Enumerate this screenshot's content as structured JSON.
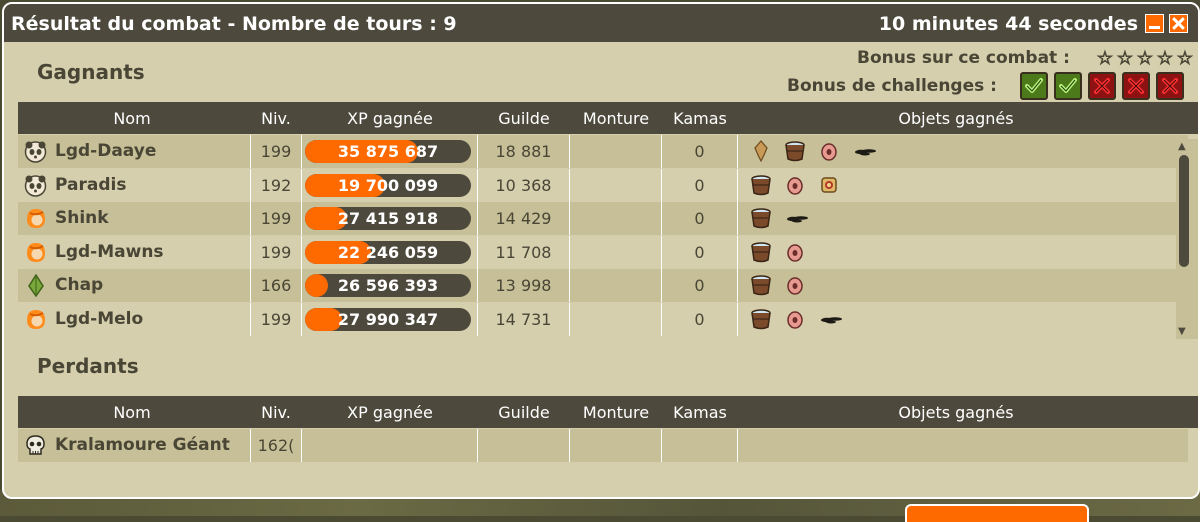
{
  "window": {
    "title": "Résultat du combat - Nombre de tours : 9",
    "timer": "10 minutes 44 secondes"
  },
  "bonus": {
    "combat_label": "Bonus sur ce combat :",
    "combat_stars": 0,
    "combat_stars_max": 5,
    "challenges_label": "Bonus de challenges :",
    "challenges": [
      "success",
      "success",
      "fail",
      "fail",
      "fail"
    ]
  },
  "columns": [
    "Nom",
    "Niv.",
    "XP gagnée",
    "Guilde",
    "Monture",
    "Kamas",
    "Objets gagnés"
  ],
  "winners": {
    "title": "Gagnants",
    "rows": [
      {
        "name": "Lgd-Daaye",
        "avatar": "panda-icon",
        "level": "199",
        "xp": "35 875 687",
        "xp_progress": 0.68,
        "guild": "18 881",
        "mount": "",
        "kamas": "0",
        "items": [
          "leaf-item-icon",
          "bucket-item-icon",
          "pink-stone-icon",
          "black-flower-icon"
        ]
      },
      {
        "name": "Paradis",
        "avatar": "panda-icon",
        "level": "192",
        "xp": "19 700 099",
        "xp_progress": 0.48,
        "guild": "10 368",
        "mount": "",
        "kamas": "0",
        "items": [
          "bucket-item-icon",
          "pink-stone-icon",
          "scroll-item-icon"
        ]
      },
      {
        "name": "Shink",
        "avatar": "cra-icon",
        "level": "199",
        "xp": "27 415 918",
        "xp_progress": 0.25,
        "guild": "14 429",
        "mount": "",
        "kamas": "0",
        "items": [
          "bucket-item-icon",
          "black-flower-icon"
        ]
      },
      {
        "name": "Lgd-Mawns",
        "avatar": "cra-icon",
        "level": "199",
        "xp": "22 246 059",
        "xp_progress": 0.4,
        "guild": "11 708",
        "mount": "",
        "kamas": "0",
        "items": [
          "bucket-item-icon",
          "pink-stone-icon"
        ]
      },
      {
        "name": "Chap",
        "avatar": "sadida-icon",
        "level": "166",
        "xp": "26 596 393",
        "xp_progress": 0.12,
        "guild": "13 998",
        "mount": "",
        "kamas": "0",
        "items": [
          "bucket-item-icon",
          "pink-stone-icon"
        ]
      },
      {
        "name": "Lgd-Melo",
        "avatar": "cra-icon",
        "level": "199",
        "xp": "27 990 347",
        "xp_progress": 0.22,
        "guild": "14 731",
        "mount": "",
        "kamas": "0",
        "items": [
          "bucket-item-icon",
          "pink-stone-icon",
          "black-flower-icon"
        ]
      }
    ]
  },
  "losers": {
    "title": "Perdants",
    "rows": [
      {
        "name": "Kralamoure Géant",
        "avatar": "skull-icon",
        "level": "162(",
        "xp": "",
        "guild": "",
        "mount": "",
        "kamas": "",
        "items": []
      }
    ]
  },
  "colors": {
    "titlebar": "#4d4a3d",
    "panel": "#d5cfae",
    "row_alt": "#c6bf97",
    "xp_fill": "#ff6a00",
    "success": "#4c7a1a",
    "fail": "#8e1212"
  }
}
